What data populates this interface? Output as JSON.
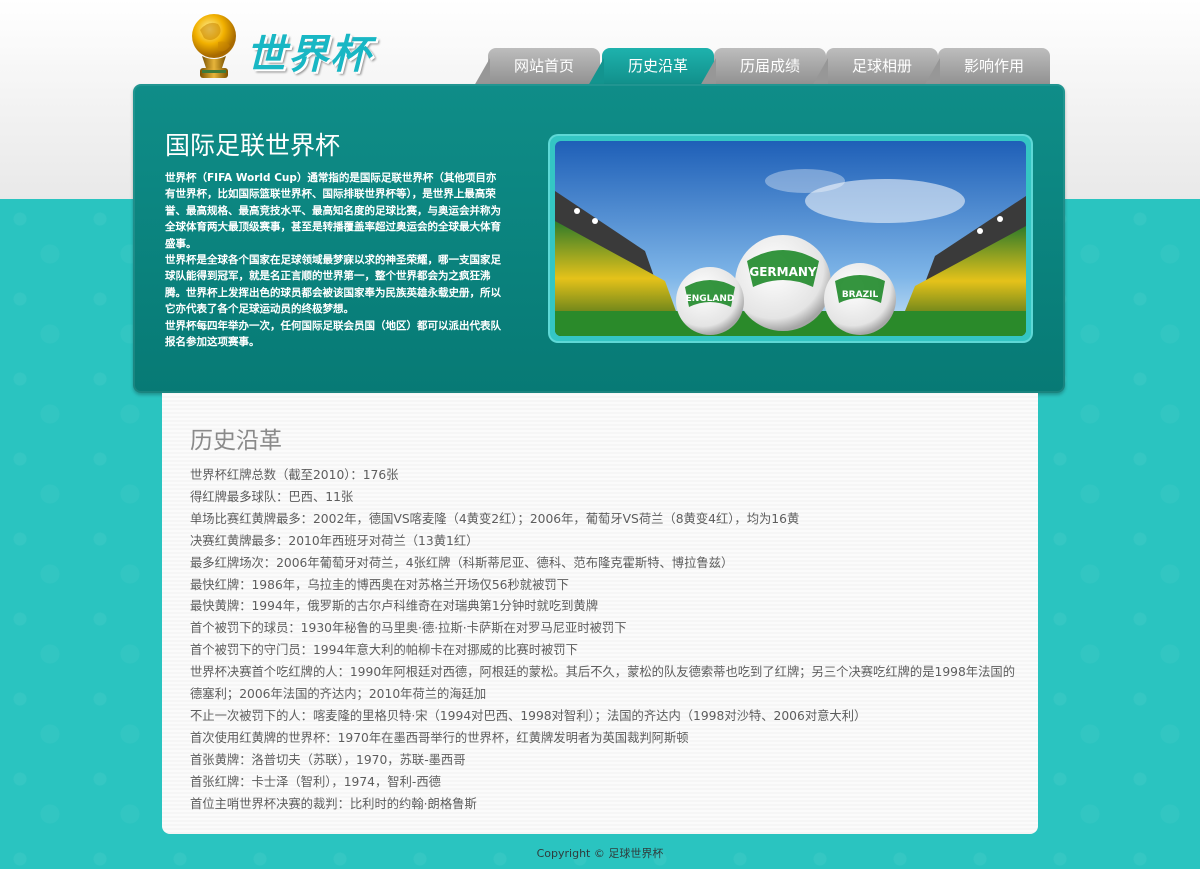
{
  "logo": {
    "text": "世界杯"
  },
  "nav": {
    "tabs": [
      {
        "label": "网站首页",
        "active": false
      },
      {
        "label": "历史沿革",
        "active": true
      },
      {
        "label": "历届成绩",
        "active": false
      },
      {
        "label": "足球相册",
        "active": false
      },
      {
        "label": "影响作用",
        "active": false
      }
    ]
  },
  "hero": {
    "title": "国际足联世界杯",
    "paragraphs": [
      "世界杯（FIFA World Cup）通常指的是国际足联世界杯（其他项目亦有世界杯，比如国际篮联世界杯、国际排联世界杯等），是世界上最高荣誉、最高规格、最高竞技水平、最高知名度的足球比赛，与奥运会并称为全球体育两大最顶级赛事，甚至是转播覆盖率超过奥运会的全球最大体育盛事。",
      "世界杯是全球各个国家在足球领域最梦寐以求的神圣荣耀，哪一支国家足球队能得到冠军，就是名正言顺的世界第一，整个世界都会为之疯狂沸腾。世界杯上发挥出色的球员都会被该国家奉为民族英雄永载史册，所以它亦代表了各个足球运动员的终极梦想。",
      "世界杯每四年举办一次，任何国际足联会员国（地区）都可以派出代表队报名参加这项赛事。"
    ],
    "image_labels": [
      "GERMANY",
      "ENGLAND",
      "BRAZIL"
    ]
  },
  "content": {
    "title": "历史沿革",
    "facts": [
      "世界杯红牌总数（截至2010）：176张",
      "得红牌最多球队：巴西、11张",
      "单场比赛红黄牌最多：2002年，德国VS喀麦隆（4黄变2红）；2006年，葡萄牙VS荷兰（8黄变4红），均为16黄",
      "决赛红黄牌最多：2010年西班牙对荷兰（13黄1红）",
      "最多红牌场次：2006年葡萄牙对荷兰，4张红牌（科斯蒂尼亚、德科、范布隆克霍斯特、博拉鲁兹）",
      "最快红牌：1986年，乌拉圭的博西奥在对苏格兰开场仅56秒就被罚下",
      "最快黄牌：1994年，俄罗斯的古尔卢科维奇在对瑞典第1分钟时就吃到黄牌",
      "首个被罚下的球员：1930年秘鲁的马里奥·德·拉斯·卡萨斯在对罗马尼亚时被罚下",
      "首个被罚下的守门员：1994年意大利的帕柳卡在对挪威的比赛时被罚下",
      "世界杯决赛首个吃红牌的人：1990年阿根廷对西德，阿根廷的蒙松。其后不久，蒙松的队友德索蒂也吃到了红牌；另三个决赛吃红牌的是1998年法国的德塞利；2006年法国的齐达内；2010年荷兰的海廷加",
      "不止一次被罚下的人：喀麦隆的里格贝特·宋（1994对巴西、1998对智利）；法国的齐达内（1998对沙特、2006对意大利）",
      "首次使用红黄牌的世界杯：1970年在墨西哥举行的世界杯，红黄牌发明者为英国裁判阿斯顿",
      "首张黄牌：洛普切夫（苏联），1970，苏联-墨西哥",
      "首张红牌：卡士泽（智利），1974，智利-西德",
      "首位主哨世界杯决赛的裁判：比利时的约翰·朗格鲁斯"
    ]
  },
  "footer": {
    "copyright": "Copyright © 足球世界杯"
  }
}
